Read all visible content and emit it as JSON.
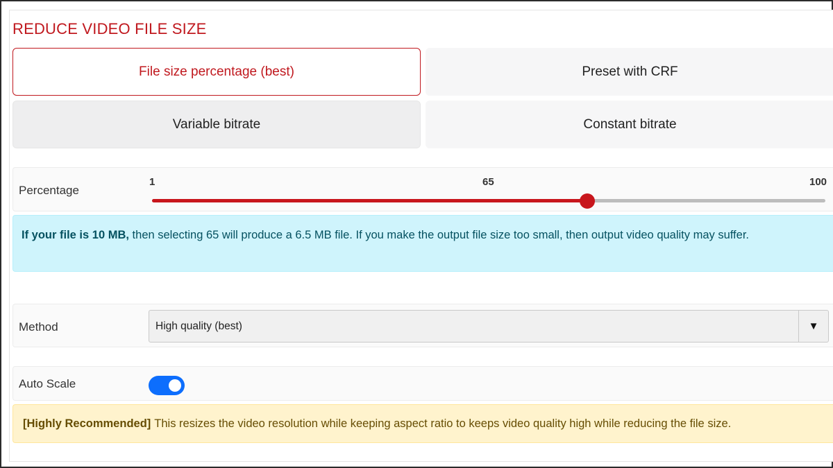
{
  "title": "REDUCE VIDEO FILE SIZE",
  "modes": [
    {
      "label": "File size percentage (best)",
      "active": true
    },
    {
      "label": "Preset with CRF",
      "active": false
    },
    {
      "label": "Variable bitrate",
      "active": false
    },
    {
      "label": "Constant bitrate",
      "active": false
    }
  ],
  "percentage": {
    "label": "Percentage",
    "min": 1,
    "max": 100,
    "value": 65,
    "min_label": "1",
    "value_label": "65",
    "max_label": "100"
  },
  "info": {
    "bold": "If your file is 10 MB,",
    "text": " then selecting 65 will produce a 6.5 MB file. If you make the output file size too small, then output video quality may suffer."
  },
  "method": {
    "label": "Method",
    "selected": "High quality (best)",
    "caret": "▼"
  },
  "auto_scale": {
    "label": "Auto Scale",
    "enabled": true
  },
  "recommendation": {
    "bold": "[Highly Recommended]",
    "text": "This resizes the video resolution while keeping aspect ratio to keeps video quality high while reducing the file size."
  },
  "colors": {
    "accent": "#c8161c",
    "toggle_on": "#0d6efd",
    "info_bg": "#cff4fc",
    "warn_bg": "#fff3cd"
  }
}
